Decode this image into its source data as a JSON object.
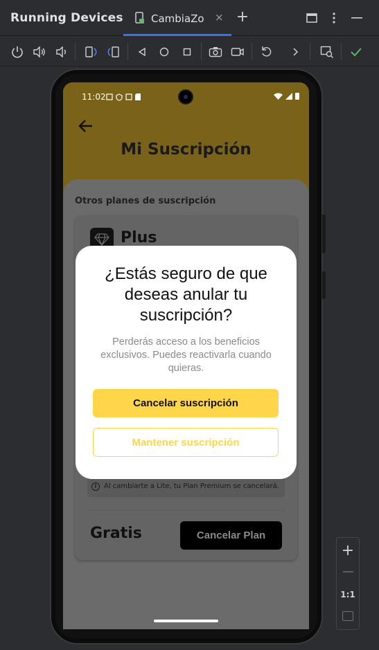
{
  "titlebar": {
    "title": "Running Devices",
    "tab_label": "CambiaZo",
    "tab_close": "×",
    "add_tab": "+"
  },
  "toolbar": {
    "icons": [
      "power-icon",
      "volume-up-icon",
      "volume-down-icon",
      "rotate-left-icon",
      "rotate-right-icon",
      "back-icon",
      "home-icon",
      "overview-icon",
      "screenshot-icon",
      "screen-record-icon",
      "undo-icon",
      "more-icon",
      "mirror-icon",
      "check-icon"
    ],
    "check_color": "#5fb865"
  },
  "phone": {
    "status_time": "11:02",
    "page_title": "Mi Suscripción",
    "section_label": "Otros planes de suscripción",
    "plan_name": "Plus",
    "notice": "Al cambiarte a Lite, tu Plan Premium se cancelará.",
    "free_label": "Gratis",
    "cancel_plan_button": "Cancelar Plan"
  },
  "dialog": {
    "title": "¿Estás seguro de que deseas anular tu suscripción?",
    "body": "Perderás acceso a los beneficios exclusivos. Puedes reactivarla cuando quieras.",
    "primary_button": "Cancelar suscripción",
    "secondary_button": "Mantener suscripción",
    "accent_color": "#ffd54a"
  },
  "zoom": {
    "zoom_in": "+",
    "actual_size": "1:1"
  }
}
